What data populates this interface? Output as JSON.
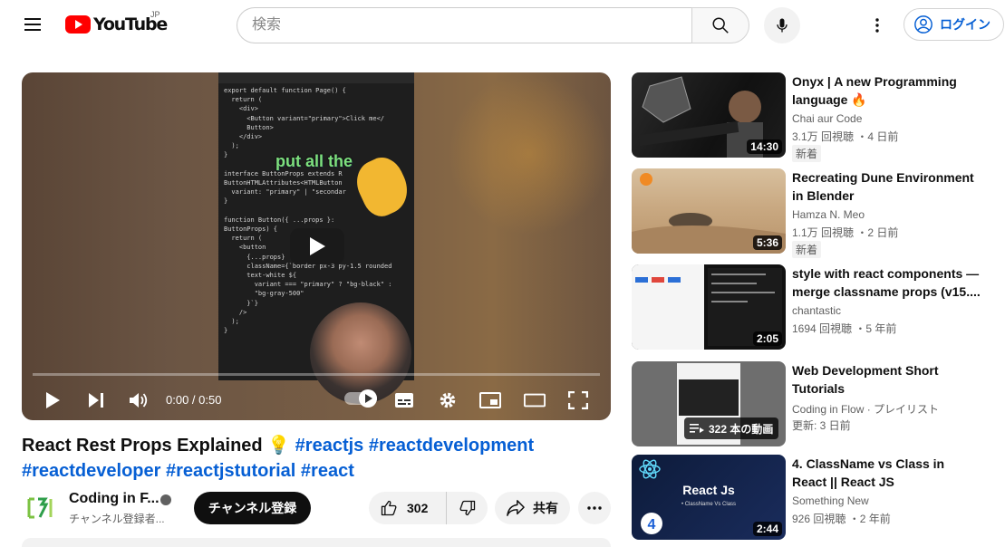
{
  "header": {
    "logo_text": "YouTube",
    "region": "JP",
    "search_placeholder": "検索",
    "login_label": "ログイン"
  },
  "player": {
    "time": "0:00 / 0:50",
    "overlay_caption": "put all the",
    "code_lines": [
      "export default function Page() {",
      "  return (",
      "    <div>",
      "      <Button variant=\"primary\">Click me</",
      "      Button>",
      "    </div>",
      "  );",
      "}",
      "",
      "interface ButtonProps extends R",
      "ButtonHTMLAttributes<HTMLButton",
      "  variant: \"primary\" | \"secondar",
      "}",
      "",
      "function Button({ ...props }:",
      "ButtonProps) {",
      "  return (",
      "    <button",
      "      {...props}",
      "      className={`border px-3 py-1.5 rounded",
      "      text-white ${",
      "        variant === \"primary\" ? \"bg-black\" :",
      "        \"bg-gray-500\"",
      "      }`}",
      "    />",
      "  );",
      "}"
    ]
  },
  "video": {
    "title_text": "React Rest Props Explained 💡 ",
    "hashtags_line1": "#reactjs #reactdevelopment",
    "hashtags_line2": "#reactdeveloper #reactjstutorial #react",
    "channel_name": "Coding in F...",
    "channel_subs": "チャンネル登録者...",
    "subscribe_label": "チャンネル登録",
    "like_count": "302",
    "share_label": "共有"
  },
  "recommendations": [
    {
      "title": "Onyx | A new Programming language 🔥",
      "channel": "Chai aur Code",
      "meta": "3.1万 回視聴 ・4 日前",
      "badge": "新着",
      "duration": "14:30",
      "thumb_color": "#1a1a1a"
    },
    {
      "title": "Recreating Dune Environment in Blender",
      "channel": "Hamza N. Meo",
      "meta": "1.1万 回視聴 ・2 日前",
      "badge": "新着",
      "duration": "5:36",
      "thumb_color": "#c9a982"
    },
    {
      "title": "style with react components — merge classname props (v15....",
      "channel": "chantastic",
      "meta": "1694 回視聴 ・5 年前",
      "badge": "",
      "duration": "2:05",
      "thumb_color": "#111111"
    },
    {
      "title": "Web Development Short Tutorials",
      "channel": "Coding in Flow · プレイリスト",
      "meta": "更新: 3 日前",
      "badge": "",
      "duration": "",
      "playlist_count": "322 本の動画",
      "thumb_color": "#6e6e6e"
    },
    {
      "title": "4. ClassName vs Class in React || React JS",
      "channel": "Something New",
      "meta": "926 回視聴 ・2 年前",
      "badge": "",
      "duration": "2:44",
      "thumb_color": "#0d1b3a",
      "thumb_text": "React Js",
      "thumb_subtext": "• ClassName Vs Class",
      "thumb_number": "4"
    }
  ],
  "colors": {
    "brand_red": "#ff0000",
    "link_blue": "#065fd4",
    "text_secondary": "#606060"
  }
}
